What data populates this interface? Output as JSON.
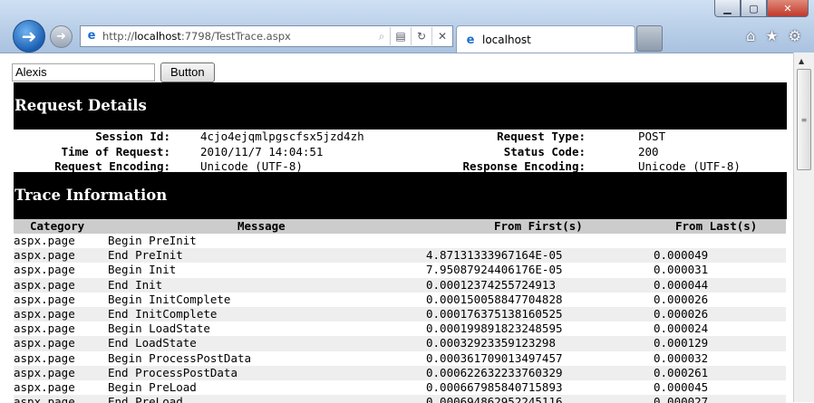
{
  "browser": {
    "url_prefix": "http://",
    "url_host": "localhost",
    "url_rest": ":7798/TestTrace.aspx",
    "tab_title": "localhost",
    "accent_color": "#1c6fd1"
  },
  "form": {
    "textbox_value": "Alexis",
    "button_label": "Button"
  },
  "request_details": {
    "heading": "Request Details",
    "rows": [
      {
        "k1": "Session Id:",
        "v1": "4cjo4ejqmlpgscfsx5jzd4zh",
        "k2": "Request Type:",
        "v2": "POST"
      },
      {
        "k1": "Time of Request:",
        "v1": "2010/11/7 14:04:51",
        "k2": "Status Code:",
        "v2": "200"
      },
      {
        "k1": "Request Encoding:",
        "v1": "Unicode (UTF-8)",
        "k2": "Response Encoding:",
        "v2": "Unicode (UTF-8)"
      }
    ]
  },
  "trace_information": {
    "heading": "Trace Information",
    "columns": [
      "Category",
      "Message",
      "From First(s)",
      "From Last(s)"
    ],
    "rows": [
      [
        "aspx.page",
        "Begin PreInit",
        "",
        ""
      ],
      [
        "aspx.page",
        "End PreInit",
        "4.87131333967164E-05",
        "0.000049"
      ],
      [
        "aspx.page",
        "Begin Init",
        "7.95087924406176E-05",
        "0.000031"
      ],
      [
        "aspx.page",
        "End Init",
        "0.00012374255724913",
        "0.000044"
      ],
      [
        "aspx.page",
        "Begin InitComplete",
        "0.000150058847704828",
        "0.000026"
      ],
      [
        "aspx.page",
        "End InitComplete",
        "0.000176375138160525",
        "0.000026"
      ],
      [
        "aspx.page",
        "Begin LoadState",
        "0.000199891823248595",
        "0.000024"
      ],
      [
        "aspx.page",
        "End LoadState",
        "0.00032923359123298",
        "0.000129"
      ],
      [
        "aspx.page",
        "Begin ProcessPostData",
        "0.000361709013497457",
        "0.000032"
      ],
      [
        "aspx.page",
        "End ProcessPostData",
        "0.000622632233760329",
        "0.000261"
      ],
      [
        "aspx.page",
        "Begin PreLoad",
        "0.000667985840715893",
        "0.000045"
      ],
      [
        "aspx.page",
        "End PreLoad",
        "0.000694862952245116",
        "0.000027"
      ]
    ]
  }
}
